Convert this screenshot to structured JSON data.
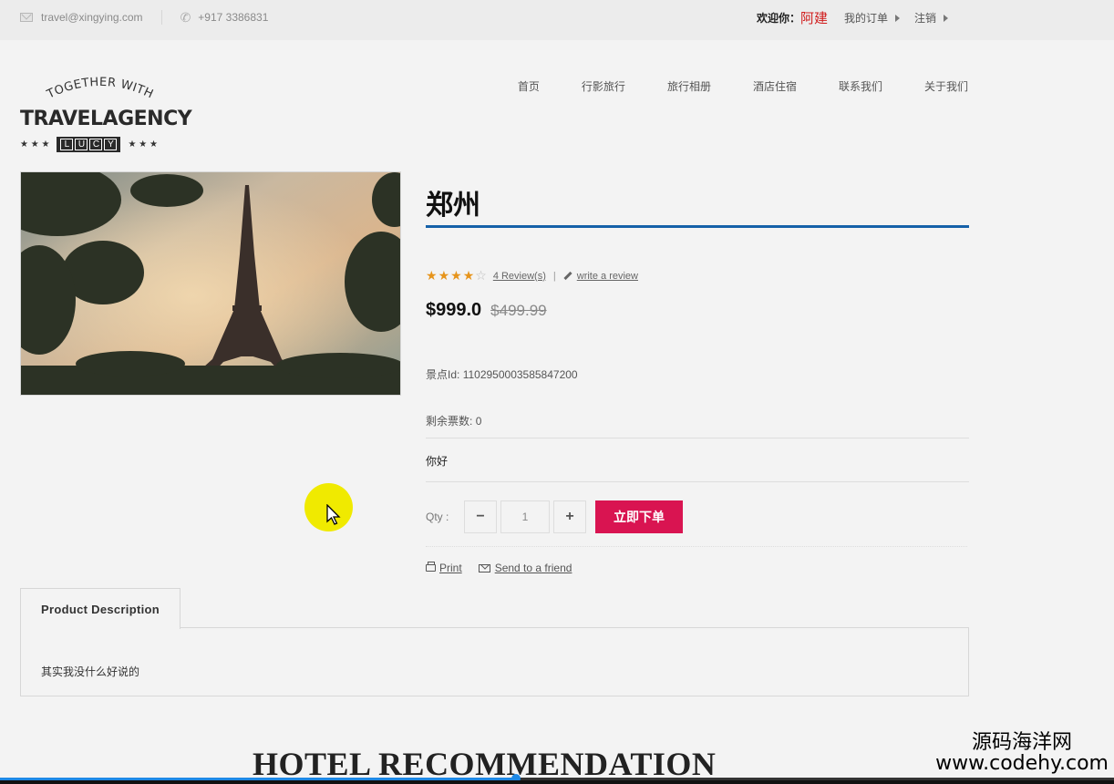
{
  "topbar": {
    "email": "travel@xingying.com",
    "phone": "+917 3386831",
    "welcome_label": "欢迎你：",
    "username": "阿建",
    "orders_link": "我的订单",
    "logout_link": "注销"
  },
  "logo": {
    "arc_text": "TOGETHER WITH",
    "title": "TRAVELAGENCY",
    "badge_letters": [
      "L",
      "U",
      "C",
      "Y"
    ],
    "stars": "★ ★ ★"
  },
  "nav": {
    "items": [
      "首页",
      "行影旅行",
      "旅行相册",
      "酒店住宿",
      "联系我们",
      "关于我们"
    ]
  },
  "product": {
    "title": "郑州",
    "rating": 4,
    "rating_max": 5,
    "reviews_link": "4 Review(s)",
    "write_review_link": "write a review",
    "price": "$999.0",
    "old_price": "$499.99",
    "scenic_id_label": "景点Id:",
    "scenic_id": "1102950003585847200",
    "tickets_label": "剩余票数:",
    "tickets": "0",
    "short_desc": "你好",
    "qty_label": "Qty :",
    "qty_minus": "−",
    "qty_value": "1",
    "qty_plus": "+",
    "order_button": "立即下单",
    "print_link": "Print",
    "send_link": "Send to a friend"
  },
  "tabs": {
    "active_tab": "Product Description",
    "content": "其实我没什么好说的"
  },
  "section": {
    "heading": "HOTEL RECOMMENDATION"
  },
  "video": {
    "progress": 0.46
  },
  "watermark": {
    "line1": "源码海洋网",
    "line2": "www.codehy.com"
  },
  "colors": {
    "accent_blue": "#1561a8",
    "order_button": "#d91451",
    "username": "#d01b1b",
    "star": "#e6941b"
  }
}
